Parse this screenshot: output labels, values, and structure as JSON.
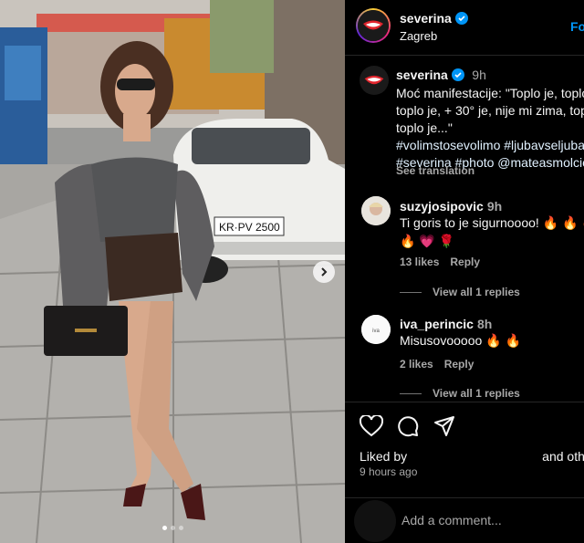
{
  "post": {
    "username": "severina",
    "location": "Zagreb",
    "follow_label": "Fo",
    "image_counter": {
      "count": 3,
      "active": 0
    }
  },
  "caption": {
    "username": "severina",
    "time": "9h",
    "line1": "Moć manifestacije: \"Toplo je, toplo",
    "line2": "toplo je, + 30° je, nije mi zima, top",
    "line3": "toplo je...\"",
    "tags1": "#volimstosevolimo #ljubavseljuba",
    "tags2": "#severina #photo @mateasmolcic",
    "see_translation": "See translation"
  },
  "comments": [
    {
      "username": "suzyjosipovic",
      "time": "9h",
      "text": "Ti goris to je sigurnoooo! 🔥 🔥 🔥",
      "text2": "🔥 💗 🌹",
      "likes": "13 likes",
      "reply": "Reply",
      "view_replies": "View all 1 replies"
    },
    {
      "username": "iva_perincic",
      "time": "8h",
      "text": "Misusovooooo 🔥 🔥",
      "likes": "2 likes",
      "reply": "Reply",
      "view_replies": "View all 1 replies"
    }
  ],
  "actions": {
    "liked_prefix": "Liked by",
    "liked_suffix": "and othe",
    "time_ago": "9 hours ago"
  },
  "add_comment": {
    "placeholder": "Add a comment..."
  },
  "colors": {
    "background": "#000000",
    "link": "#0095f6",
    "secondary_text": "#a8a8a8",
    "verified": "#0095f6"
  },
  "icons": [
    "verified-icon",
    "heart-icon",
    "comment-icon",
    "share-icon",
    "next-arrow-icon"
  ]
}
